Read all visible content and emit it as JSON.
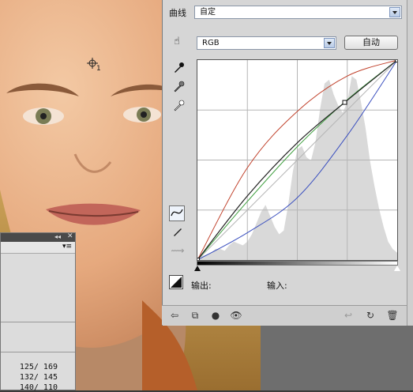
{
  "curves_panel": {
    "channel_label": "曲线",
    "preset_value": "自定",
    "channel_value": "RGB",
    "auto_button": "自动",
    "output_label": "输出:",
    "input_label": "输入:"
  },
  "photo": {
    "sampler_marker": "1"
  },
  "info_panel": {
    "values": [
      "125/ 169",
      "132/ 145",
      "140/ 110"
    ]
  },
  "colors": {
    "curve_red": "#c0402a",
    "curve_green": "#3f9f3f",
    "curve_blue": "#3a4fbf",
    "curve_rgb": "#222222"
  },
  "chart_data": {
    "type": "line",
    "xlim": [
      0,
      255
    ],
    "ylim": [
      0,
      255
    ],
    "grid": true,
    "series": [
      {
        "color": "red",
        "points": [
          [
            0,
            0
          ],
          [
            64,
            118
          ],
          [
            128,
            190
          ],
          [
            192,
            235
          ],
          [
            255,
            255
          ]
        ]
      },
      {
        "color": "green",
        "points": [
          [
            0,
            0
          ],
          [
            64,
            75
          ],
          [
            128,
            145
          ],
          [
            192,
            205
          ],
          [
            255,
            255
          ]
        ]
      },
      {
        "color": "blue",
        "points": [
          [
            0,
            0
          ],
          [
            64,
            35
          ],
          [
            128,
            80
          ],
          [
            192,
            160
          ],
          [
            255,
            255
          ]
        ]
      },
      {
        "color": "rgb",
        "points": [
          [
            0,
            0
          ],
          [
            64,
            82
          ],
          [
            128,
            150
          ],
          [
            188,
            201
          ],
          [
            255,
            255
          ]
        ]
      }
    ]
  }
}
